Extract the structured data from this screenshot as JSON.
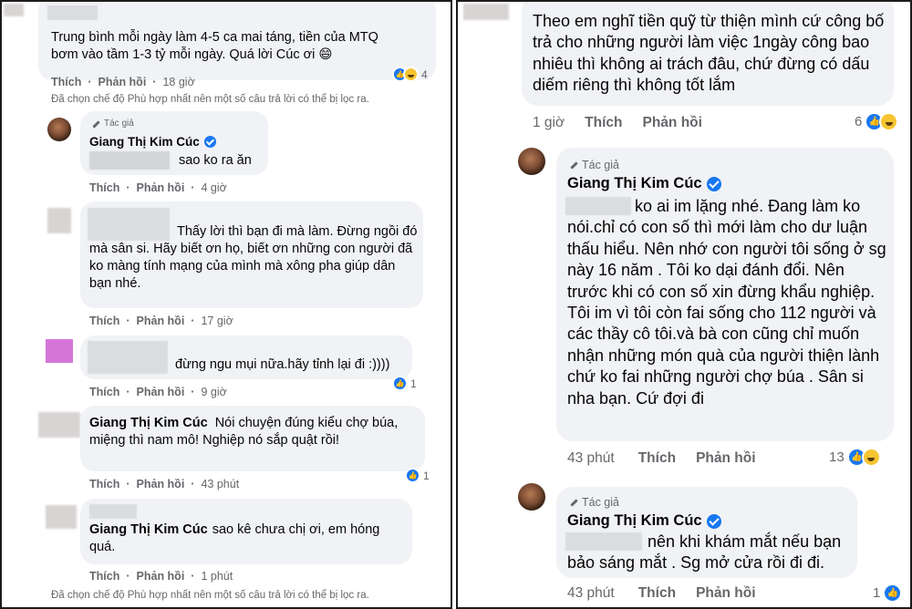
{
  "left": {
    "c1": {
      "text": "Trung bình mỗi ngày làm 4-5 ca mai táng, tiền của MTQ bơm vào tầm 1-3 tỷ mỗi ngày. Quá lời Cúc ơi 😄",
      "like": "Thích",
      "reply": "Phản hồi",
      "time": "18 giờ",
      "reaction_count": "4"
    },
    "notice_top": "Đã chọn chế độ Phù hợp nhất nên một số câu trả lời có thể bị lọc ra.",
    "c2": {
      "author_tag": "Tác giả",
      "author": "Giang Thị Kim Cúc",
      "text": "sao ko ra ăn",
      "like": "Thích",
      "reply": "Phản hồi",
      "time": "4 giờ"
    },
    "c3": {
      "text": "Thấy lời thì bạn đi mà làm. Đừng ngồi đó mà sân si. Hãy biết ơn họ, biết ơn những con người đã ko màng tính mạng của mình mà xông pha giúp dân bạn nhé.",
      "like": "Thích",
      "reply": "Phản hồi",
      "time": "17 giờ"
    },
    "c4": {
      "text": "đừng ngu mụi nữa.hãy tỉnh lại đi :))))",
      "like": "Thích",
      "reply": "Phản hồi",
      "time": "9 giờ",
      "reaction_count": "1"
    },
    "c5": {
      "author": "Giang Thị Kim Cúc",
      "text": "Nói chuyện đúng kiểu chợ búa, miệng thì nam mô! Nghiệp nó sắp quật rồi!",
      "like": "Thích",
      "reply": "Phản hồi",
      "time": "43 phút",
      "reaction_count": "1"
    },
    "c6": {
      "author": "Giang Thị Kim Cúc",
      "text": "sao kê chưa chị ơi, em hóng quá.",
      "like": "Thích",
      "reply": "Phản hồi",
      "time": "1 phút"
    },
    "notice_bottom": "Đã chọn chế độ Phù hợp nhất nên một số câu trả lời có thể bị lọc ra."
  },
  "right": {
    "c1": {
      "text": "Theo em nghĩ tiền quỹ từ thiện mình cứ công bố trả cho những người làm việc 1ngày công bao nhiêu thì không ai trách đâu, chứ đừng có dấu diếm riêng thì không tốt lắm",
      "time": "1 giờ",
      "like": "Thích",
      "reply": "Phản hồi",
      "reaction_count": "6"
    },
    "c2": {
      "author_tag": "Tác giả",
      "author": "Giang Thị Kim Cúc",
      "text": "ko ai im lặng nhé. Đang làm ko nói.chỉ có con số thì mới làm cho dư luận thấu hiểu. Nên nhớ con người tôi sống ở sg này 16 năm . Tôi ko dại đánh đổi. Nên trước khi có con số xin đừng khẩu nghiệp. Tôi im vì tôi còn fai sống cho 112 người và các thầy cô tôi.và bà con cũng chỉ muốn nhận những món quà của người thiện lành chứ ko fai những người chợ búa . Sân si nha bạn. Cứ đợi đi",
      "time": "43 phút",
      "like": "Thích",
      "reply": "Phản hồi",
      "reaction_count": "13"
    },
    "c3": {
      "author_tag": "Tác giả",
      "author": "Giang Thị Kim Cúc",
      "text": "nên khi khám mắt nếu bạn bảo sáng mắt . Sg mở cửa rồi đi đi.",
      "time": "43 phút",
      "like": "Thích",
      "reply": "Phản hồi",
      "reaction_count": "1"
    }
  }
}
